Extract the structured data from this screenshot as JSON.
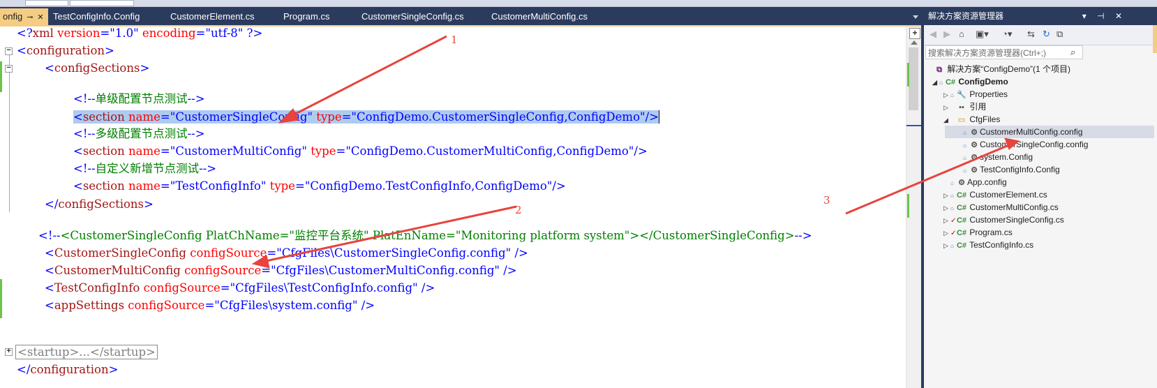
{
  "tabs": [
    {
      "label": "onfig",
      "active": true,
      "pin": "⊸",
      "close": "✕"
    },
    {
      "label": "TestConfigInfo.Config"
    },
    {
      "label": "CustomerElement.cs"
    },
    {
      "label": "Program.cs"
    },
    {
      "label": "CustomerSingleConfig.cs"
    },
    {
      "label": "CustomerMultiConfig.cs"
    }
  ],
  "editor": {
    "lines": [
      {
        "id": "l0",
        "parts": [
          "<?",
          "xml",
          " version",
          "=",
          "\"1.0\"",
          " encoding",
          "=",
          "\"utf-8\"",
          " ?>"
        ]
      },
      {
        "id": "l1",
        "parts": [
          "<",
          "configuration",
          ">"
        ]
      },
      {
        "id": "l2",
        "parts": [
          "<",
          "configSections",
          ">"
        ]
      },
      {
        "id": "l3",
        "parts": [
          "<!--",
          "单级配置节点测试",
          "-->"
        ]
      },
      {
        "id": "l4",
        "parts": [
          "<",
          "section",
          " name",
          "=",
          "\"CustomerSingleConfig\"",
          " type",
          "=",
          "\"ConfigDemo.CustomerSingleConfig,ConfigDemo\"",
          "/>"
        ]
      },
      {
        "id": "l5",
        "parts": [
          "<!--",
          "多级配置节点测试",
          "-->"
        ]
      },
      {
        "id": "l6",
        "parts": [
          "<",
          "section",
          " name",
          "=",
          "\"CustomerMultiConfig\"",
          " type",
          "=",
          "\"ConfigDemo.CustomerMultiConfig,ConfigDemo\"",
          "/>"
        ]
      },
      {
        "id": "l7",
        "parts": [
          "<!--",
          "自定义新增节点测试",
          "-->"
        ]
      },
      {
        "id": "l8",
        "parts": [
          "<",
          "section",
          " name",
          "=",
          "\"TestConfigInfo\"",
          " type",
          "=",
          "\"ConfigDemo.TestConfigInfo,ConfigDemo\"",
          "/>"
        ]
      },
      {
        "id": "l9",
        "parts": [
          "</",
          "configSections",
          ">"
        ]
      },
      {
        "id": "l10",
        "parts": [
          "<!--",
          "<CustomerSingleConfig PlatChName=\"监控平台系统\" PlatEnName=\"Monitoring platform system\"></CustomerSingleConfig>",
          "-->"
        ]
      },
      {
        "id": "l11",
        "parts": [
          "<",
          "CustomerSingleConfig",
          " configSource",
          "=",
          "\"CfgFiles\\CustomerSingleConfig.config\"",
          " />"
        ]
      },
      {
        "id": "l12",
        "parts": [
          "<",
          "CustomerMultiConfig",
          " configSource",
          "=",
          "\"CfgFiles\\CustomerMultiConfig.config\"",
          " />"
        ]
      },
      {
        "id": "l13",
        "parts": [
          "<",
          "TestConfigInfo",
          " configSource",
          "=",
          "\"CfgFiles\\TestConfigInfo.config\"",
          " />"
        ]
      },
      {
        "id": "l14",
        "parts": [
          "<",
          "appSettings",
          " configSource",
          "=",
          "\"CfgFiles\\system.config\"",
          " />"
        ]
      },
      {
        "id": "l15",
        "parts": [
          "<startup>...</startup>"
        ]
      },
      {
        "id": "l16",
        "parts": [
          "</",
          "configuration",
          ">"
        ]
      }
    ]
  },
  "solution_explorer": {
    "title": "解决方案资源管理器",
    "title_buttons": "▾ ⊣ ✕",
    "search_placeholder": "搜索解决方案资源管理器(Ctrl+;)",
    "search_icon": "⌕",
    "toolbar_icons": [
      "back-icon",
      "forward-icon",
      "home-icon",
      "switch-views-icon",
      "pending-changes-icon",
      "sync-icon",
      "refresh-icon",
      "collapse-all-icon"
    ],
    "tree": [
      {
        "label": "解决方案“ConfigDemo”(1 个项目)",
        "icon": "sln-icon",
        "glyph": "⧉"
      },
      {
        "label": "ConfigDemo",
        "icon": "csharp-project-icon",
        "glyph": "C#",
        "expanded": true
      },
      {
        "label": "Properties",
        "icon": "properties-icon",
        "glyph": "🔧"
      },
      {
        "label": "引用",
        "icon": "references-icon",
        "glyph": "▪▪"
      },
      {
        "label": "CfgFiles",
        "icon": "folder-icon",
        "glyph": "▭",
        "expanded": true
      },
      {
        "label": "CustomerMultiConfig.config",
        "icon": "config-file-icon",
        "glyph": "⚙",
        "selected": true
      },
      {
        "label": "CustomerSingleConfig.config",
        "icon": "config-file-icon",
        "glyph": "⚙"
      },
      {
        "label": "system.Config",
        "icon": "config-file-icon",
        "glyph": "⚙"
      },
      {
        "label": "TestConfigInfo.Config",
        "icon": "config-file-icon",
        "glyph": "⚙"
      },
      {
        "label": "App.config",
        "icon": "config-file-icon",
        "glyph": "⚙"
      },
      {
        "label": "CustomerElement.cs",
        "icon": "csharp-file-icon",
        "glyph": "C#"
      },
      {
        "label": "CustomerMultiConfig.cs",
        "icon": "csharp-file-icon",
        "glyph": "C#"
      },
      {
        "label": "CustomerSingleConfig.cs",
        "icon": "csharp-file-icon",
        "glyph": "C#",
        "modified": true
      },
      {
        "label": "Program.cs",
        "icon": "csharp-file-icon",
        "glyph": "C#",
        "modified": true
      },
      {
        "label": "TestConfigInfo.cs",
        "icon": "csharp-file-icon",
        "glyph": "C#"
      }
    ]
  },
  "annotations": {
    "labels": [
      "1",
      "2",
      "3"
    ],
    "color": "#e8433d"
  },
  "colors": {
    "tab_bar": "#2b3b5e",
    "active_tab": "#f5cc84",
    "xml_delimiter": "#0000ff",
    "xml_element": "#a31515",
    "xml_attribute": "#ff0000",
    "xml_comment": "#008000",
    "selection": "#aecbf0"
  }
}
